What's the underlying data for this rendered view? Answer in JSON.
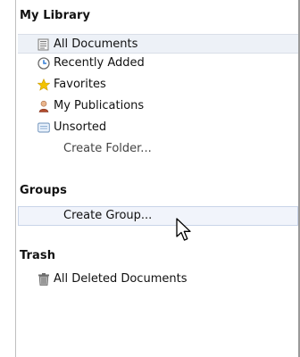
{
  "sections": {
    "my_library": {
      "title": "My Library",
      "items": [
        {
          "label": "All Documents",
          "icon": "documents-icon"
        },
        {
          "label": "Recently Added",
          "icon": "clock-icon"
        },
        {
          "label": "Favorites",
          "icon": "star-icon"
        },
        {
          "label": "My Publications",
          "icon": "person-icon"
        },
        {
          "label": "Unsorted",
          "icon": "inbox-icon"
        }
      ],
      "create_folder": "Create Folder..."
    },
    "groups": {
      "title": "Groups",
      "create_group": "Create Group..."
    },
    "trash": {
      "title": "Trash",
      "items": [
        {
          "label": "All Deleted Documents",
          "icon": "trash-icon"
        }
      ]
    }
  },
  "colors": {
    "selection_bg": "#edf1f7",
    "hover_border": "#c9d4e8",
    "star": "#f3c300",
    "clock": "#2f7bd6"
  }
}
